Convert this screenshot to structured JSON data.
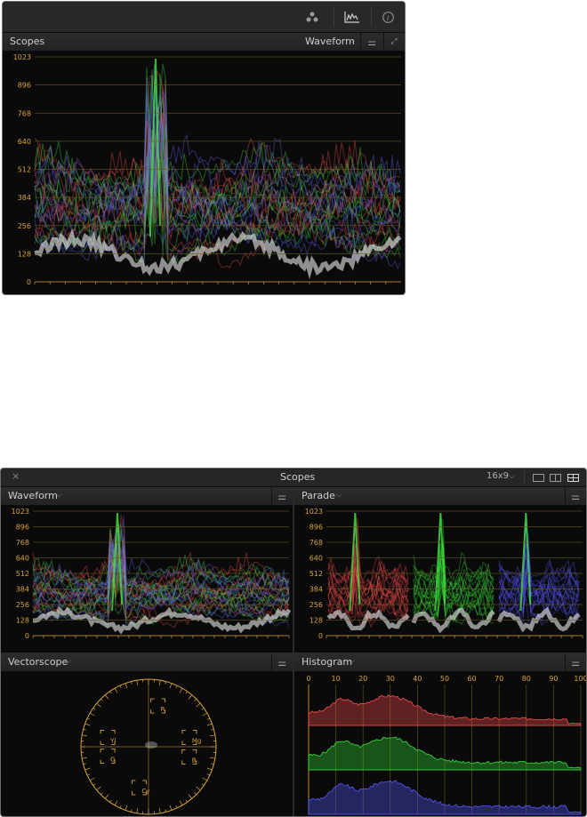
{
  "top_panel": {
    "toolbar_icons": [
      "nodes-icon",
      "scope-waveform-icon",
      "info-icon"
    ],
    "title": "Scopes",
    "mode": "Waveform",
    "y_ticks": [
      "1023",
      "896",
      "768",
      "640",
      "512",
      "384",
      "256",
      "128",
      "0"
    ]
  },
  "bottom_window": {
    "close_label": "×",
    "title": "Scopes",
    "aspect": "16x9",
    "layouts": [
      "single-layout-icon",
      "dual-layout-icon",
      "quad-layout-icon"
    ],
    "waveform": {
      "title": "Waveform",
      "y_ticks": [
        "1023",
        "896",
        "768",
        "640",
        "512",
        "384",
        "256",
        "128",
        "0"
      ]
    },
    "parade": {
      "title": "Parade",
      "y_ticks": [
        "1023",
        "896",
        "768",
        "640",
        "512",
        "384",
        "256",
        "128",
        "0"
      ]
    },
    "vectorscope": {
      "title": "Vectorscope",
      "targets": [
        "R",
        "Mg",
        "B",
        "Cy",
        "G",
        "Yl"
      ]
    },
    "histogram": {
      "title": "Histogram",
      "x_ticks": [
        "0",
        "10",
        "20",
        "30",
        "40",
        "50",
        "60",
        "70",
        "80",
        "90",
        "100"
      ]
    }
  },
  "colors": {
    "tick": "#d8a43a",
    "panel_bg": "#161616",
    "header_bg": "#2a2a2c",
    "red": "#ff4d4d",
    "green": "#36e23a",
    "blue": "#5a5aff"
  }
}
